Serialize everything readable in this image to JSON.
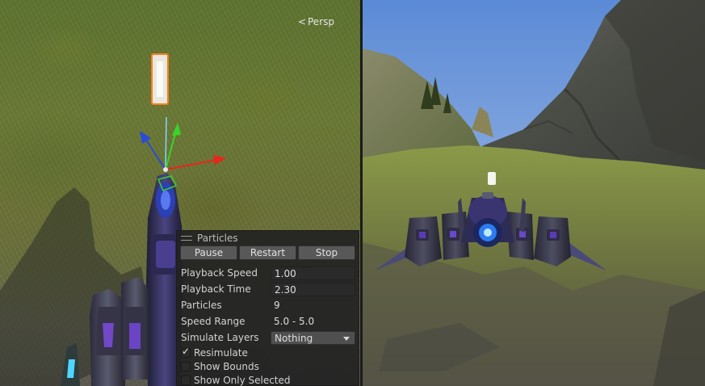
{
  "scene_view": {
    "camera_mode_label": "Persp",
    "camera_mode_icon": "chevron-left-icon"
  },
  "particle_panel": {
    "title": "Particles",
    "buttons": {
      "pause": "Pause",
      "restart": "Restart",
      "stop": "Stop"
    },
    "properties": {
      "playback_speed": {
        "label": "Playback Speed",
        "value": "1.00"
      },
      "playback_time": {
        "label": "Playback Time",
        "value": "2.30"
      },
      "particles": {
        "label": "Particles",
        "value": "9"
      },
      "speed_range": {
        "label": "Speed Range",
        "value": "5.0 - 5.0"
      },
      "simulate_layers": {
        "label": "Simulate Layers",
        "value": "Nothing"
      }
    },
    "checkboxes": {
      "resimulate": {
        "label": "Resimulate",
        "checked": true
      },
      "show_bounds": {
        "label": "Show Bounds",
        "checked": false
      },
      "show_only_selected": {
        "label": "Show Only Selected",
        "checked": false
      }
    }
  },
  "colors": {
    "selection_outline": "#ff7a1a",
    "gizmo_x_axis": "#e8261c",
    "gizmo_y_axis": "#38d42b",
    "gizmo_z_axis": "#2a4bd8",
    "panel_background": "#222222",
    "sky": "#6f9ad8",
    "grass": "#6b7a36"
  }
}
